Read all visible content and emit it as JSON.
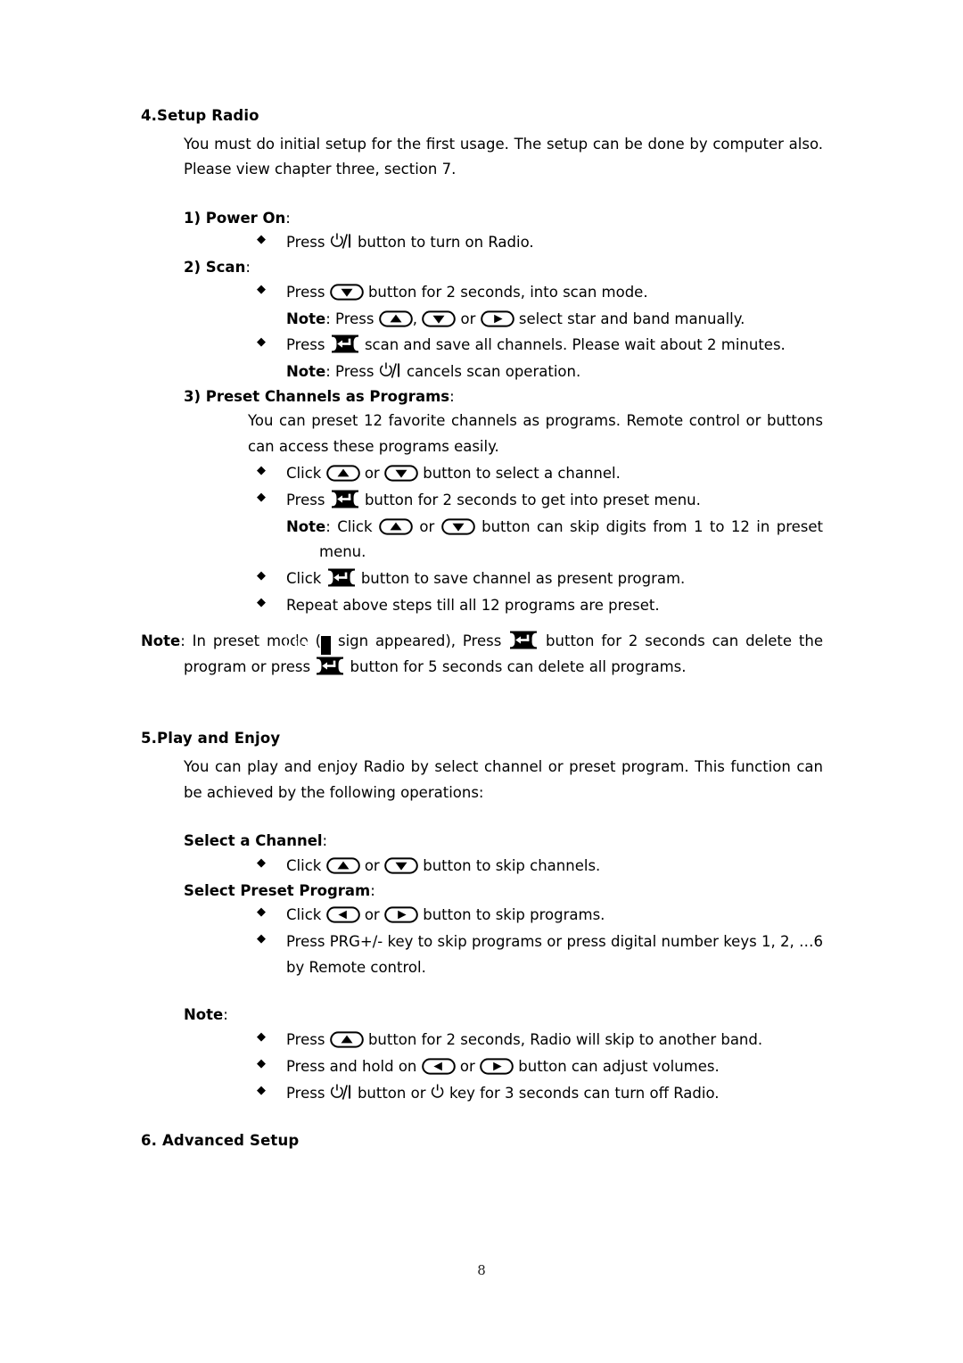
{
  "document": {
    "page_number": "8",
    "sections": [
      {
        "id": "setup-radio",
        "heading": "4.Setup Radio",
        "intro": "You must do initial setup for the first usage. The setup can be done by computer also. Please view chapter three, section 7."
      },
      {
        "id": "play-and-enjoy",
        "heading": "5.Play and Enjoy",
        "intro": "You can play and enjoy Radio by select channel or preset program. This function can be achieved by the following operations:"
      },
      {
        "id": "advanced-setup",
        "heading": "6. Advanced Setup"
      }
    ]
  },
  "power_on": {
    "heading_bold": "1) Power On",
    "heading_colon": ":",
    "bullet1_pre": "Press",
    "bullet1_post": "button to turn on Radio."
  },
  "scan": {
    "heading_bold": "2) Scan",
    "heading_colon": ":",
    "bullet1_pre": "Press",
    "bullet1_post": "button for 2 seconds, into scan mode.",
    "note1_label": "Note",
    "note1_pre": ": Press",
    "note1_mid_comma": ",",
    "note1_mid_or": "or",
    "note1_post": "select star and band manually.",
    "bullet2_pre": "Press",
    "bullet2_post": "scan and save all channels. Please wait about 2 minutes.",
    "note2_label": "Note",
    "note2_pre": ":  Press",
    "note2_post": "cancels scan operation."
  },
  "preset_channels": {
    "heading_bold": "3) Preset Channels as Programs",
    "heading_colon": ":",
    "intro": "You can preset 12 favorite channels as programs. Remote control or buttons can access these programs easily.",
    "bullet1_pre": "Click",
    "bullet1_or": "or",
    "bullet1_post": "button to select a channel.",
    "bullet2_pre": "Press",
    "bullet2_post": "button for 2 seconds to get into preset menu.",
    "note_label": "Note",
    "note_pre": ": Click",
    "note_or": "or",
    "note_post": "button can skip digits from 1 to 12 in preset menu.",
    "bullet3_pre": "Click",
    "bullet3_post": "button to save channel as present program.",
    "bullet4": "Repeat above steps till all 12 programs are preset."
  },
  "preset_note": {
    "label": "Note",
    "part1": ": In preset mode (",
    "badge": "List",
    "part2": "sign appeared), Press",
    "part3": "button for 2 seconds can delete the program or press",
    "part4": "button for 5 seconds can delete all programs."
  },
  "select_channel": {
    "heading_bold": "Select a Channel",
    "heading_colon": ":",
    "bullet1_pre": "Click",
    "bullet1_or": "or",
    "bullet1_post": "button to skip channels."
  },
  "select_preset_program": {
    "heading_bold": "Select Preset Program",
    "heading_colon": ":",
    "bullet1_pre": "Click",
    "bullet1_or": "or",
    "bullet1_post": "button to skip programs.",
    "bullet2": "Press PRG+/- key to skip programs or press digital number keys 1, 2, …6 by Remote control."
  },
  "final_note": {
    "label": "Note",
    "colon": ":",
    "bullet1_pre": "Press",
    "bullet1_post": "button for 2 seconds, Radio will skip to another band.",
    "bullet2_pre": "Press and hold on",
    "bullet2_or": "or",
    "bullet2_post": "button can adjust volumes.",
    "bullet3_pre": "Press",
    "bullet3_mid": "button or",
    "bullet3_post": "key for 3 seconds can turn off Radio."
  },
  "icons": {
    "power_slash": "power-standby-icon",
    "power_only": "power-symbol-icon",
    "up": "up-arrow-button-icon",
    "down": "down-arrow-button-icon",
    "left": "left-arrow-button-icon",
    "right": "right-arrow-button-icon",
    "enter": "enter-key-icon",
    "bullet": "diamond-bullet-icon"
  },
  "colors": {
    "ink": "#000000",
    "paper": "#ffffff"
  }
}
